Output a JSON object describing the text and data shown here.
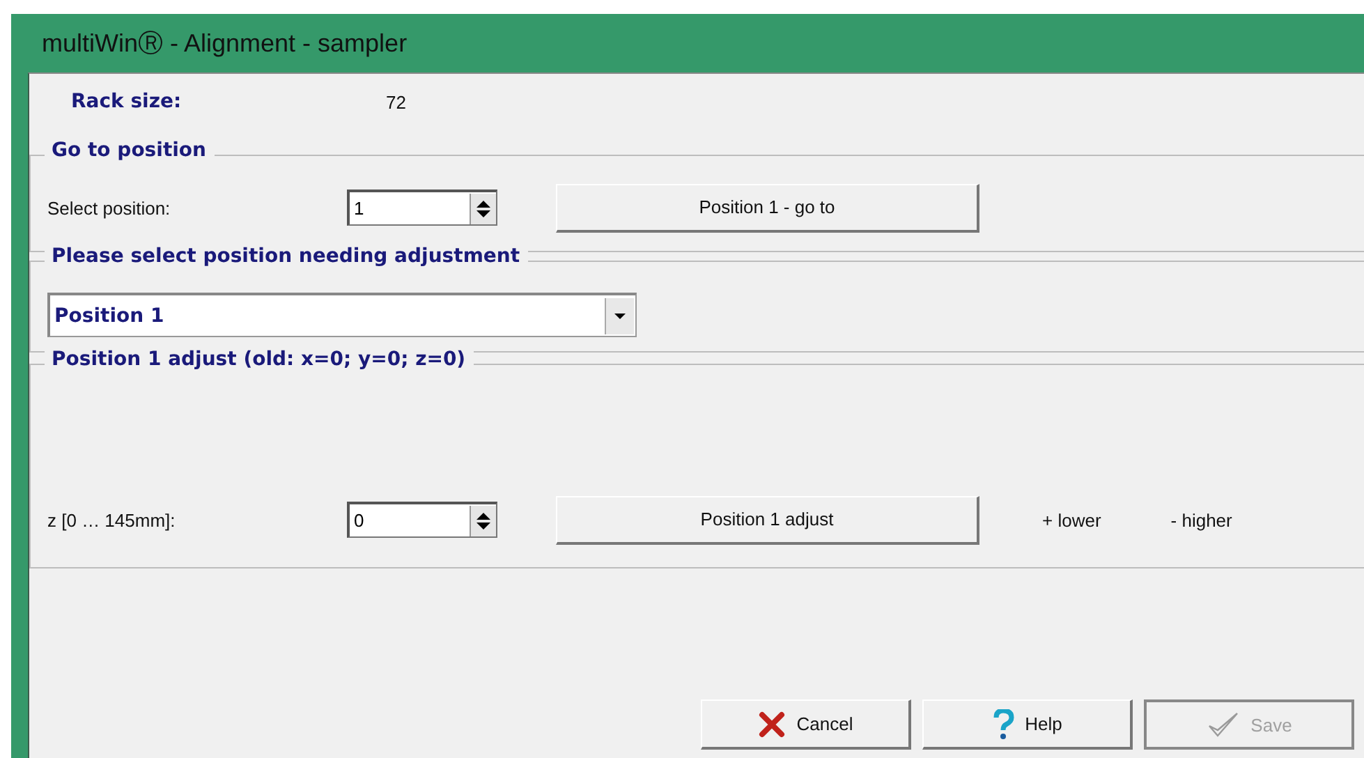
{
  "window": {
    "title": "multiWinⓇ - Alignment - sampler"
  },
  "rack_size": {
    "label": "Rack size:",
    "value": "72"
  },
  "go_to_position": {
    "title": "Go to position",
    "label": "Select position:",
    "value": "1",
    "button": "Position 1 - go to"
  },
  "select_adjustment": {
    "title": "Please select position needing adjustment",
    "value": "Position 1"
  },
  "adjust": {
    "title": "Position 1  adjust  (old: x=0; y=0; z=0)",
    "label": "z [0 … 145mm]:",
    "value": "0",
    "button": "Position 1  adjust",
    "hints": [
      "+ lower",
      "- higher"
    ]
  },
  "buttons": [
    {
      "kind": "cancel",
      "label": "Cancel",
      "disabled": false
    },
    {
      "kind": "help",
      "label": "Help",
      "disabled": false
    },
    {
      "kind": "save",
      "label": "Save",
      "disabled": true
    }
  ]
}
